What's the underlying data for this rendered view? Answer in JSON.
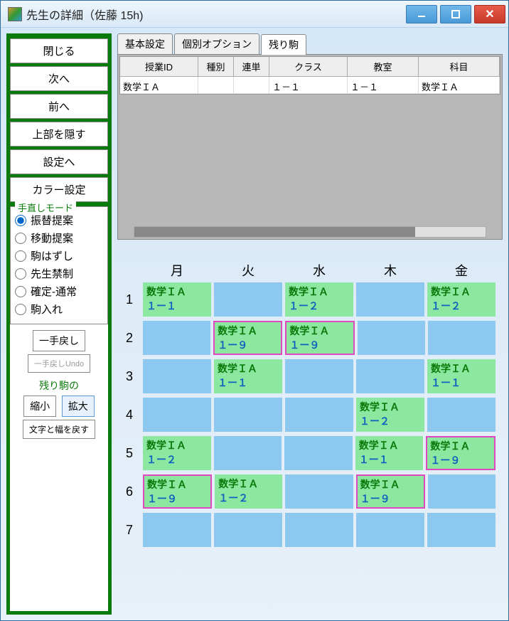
{
  "window": {
    "title": "先生の詳細（佐藤 15h)"
  },
  "sidebar": {
    "buttons": {
      "close": "閉じる",
      "next": "次へ",
      "prev": "前へ",
      "hidetop": "上部を隠す",
      "tosettings": "設定へ",
      "colorsettings": "カラー設定"
    },
    "mode": {
      "title": "手直しモード",
      "options": [
        {
          "label": "振替提案",
          "checked": true
        },
        {
          "label": "移動提案",
          "checked": false
        },
        {
          "label": "駒はずし",
          "checked": false
        },
        {
          "label": "先生禁制",
          "checked": false
        },
        {
          "label": "確定-通常",
          "checked": false
        },
        {
          "label": "駒入れ",
          "checked": false
        }
      ]
    },
    "undo": "一手戻し",
    "undolabel": "一手戻しUndo",
    "remain_label": "残り駒の",
    "shrink": "縮小",
    "expand": "拡大",
    "resetwidth": "文字と幅を戻す"
  },
  "tabs": {
    "basic": "基本設定",
    "indiv": "個別オプション",
    "remain": "残り駒"
  },
  "grid": {
    "headers": {
      "id": "授業ID",
      "type": "種別",
      "ren": "連単",
      "class": "クラス",
      "room": "教室",
      "subj": "科目"
    },
    "rows": [
      {
        "id": "数学ＩＡ",
        "type": "",
        "ren": "",
        "class": "１－１",
        "room": "１－１",
        "subj": "数学ＩＡ"
      }
    ]
  },
  "schedule": {
    "days": [
      "月",
      "火",
      "水",
      "木",
      "金"
    ],
    "periods": [
      "1",
      "2",
      "3",
      "4",
      "5",
      "6",
      "7"
    ],
    "cells": [
      [
        {
          "subj": "数学ＩＡ",
          "class": "１ー１",
          "pink": false
        },
        null,
        {
          "subj": "数学ＩＡ",
          "class": "１ー２",
          "pink": false
        },
        null,
        {
          "subj": "数学ＩＡ",
          "class": "１ー２",
          "pink": false
        }
      ],
      [
        null,
        {
          "subj": "数学ＩＡ",
          "class": "１ー９",
          "pink": true
        },
        {
          "subj": "数学ＩＡ",
          "class": "１ー９",
          "pink": true
        },
        null,
        null
      ],
      [
        null,
        {
          "subj": "数学ＩＡ",
          "class": "１ー１",
          "pink": false
        },
        null,
        null,
        {
          "subj": "数学ＩＡ",
          "class": "１ー１",
          "pink": false
        }
      ],
      [
        null,
        null,
        null,
        {
          "subj": "数学ＩＡ",
          "class": "１ー２",
          "pink": false
        },
        null
      ],
      [
        {
          "subj": "数学ＩＡ",
          "class": "１ー２",
          "pink": false
        },
        null,
        null,
        {
          "subj": "数学ＩＡ",
          "class": "１ー１",
          "pink": false
        },
        {
          "subj": "数学ＩＡ",
          "class": "１ー９",
          "pink": true
        }
      ],
      [
        {
          "subj": "数学ＩＡ",
          "class": "１ー９",
          "pink": true
        },
        {
          "subj": "数学ＩＡ",
          "class": "１ー２",
          "pink": false
        },
        null,
        {
          "subj": "数学ＩＡ",
          "class": "１ー９",
          "pink": true
        },
        null
      ],
      [
        null,
        null,
        null,
        null,
        null
      ]
    ]
  }
}
